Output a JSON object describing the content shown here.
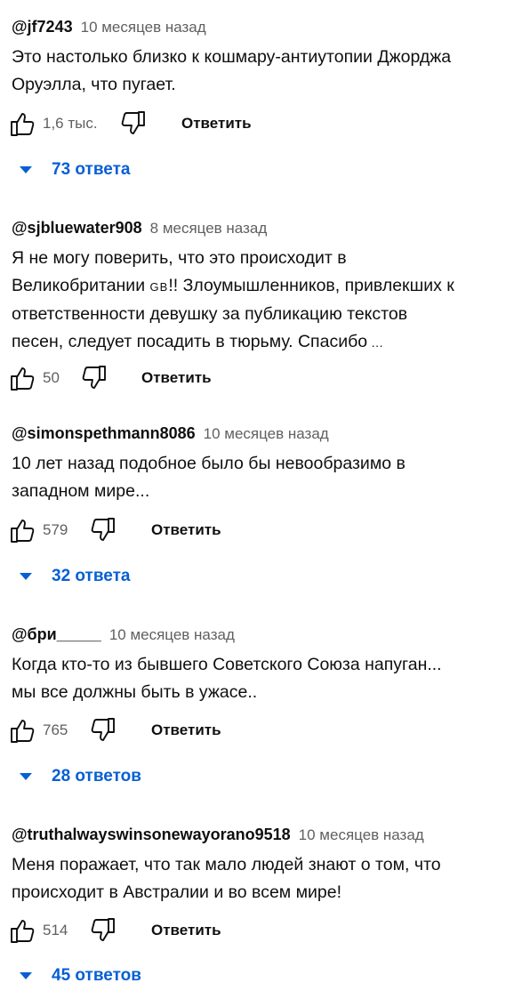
{
  "comments": [
    {
      "author": "@jf7243",
      "time": "10 месяцев назад",
      "lines": [
        "Это настолько близко к кошмару-антиутопии Джорджа",
        "Оруэлла, что пугает."
      ],
      "likes": "1,6 тыс.",
      "reply_label": "Ответить",
      "replies": "73 ответа"
    },
    {
      "author": "@sjbluewater908",
      "time": "8 месяцев назад",
      "lines": [
        "Я не могу поверить, что это происходит в",
        "Великобритании",
        "!! Злоумышленников, привлекших к",
        "ответственности девушку за публикацию текстов",
        "песен, следует посадить в тюрьму. Спасибо"
      ],
      "flag_text": "GB",
      "truncation": "…",
      "likes": "50",
      "reply_label": "Ответить"
    },
    {
      "author": "@simonspethmann8086",
      "time": "10 месяцев назад",
      "lines": [
        "10 лет назад подобное было бы невообразимо в",
        "западном мире..."
      ],
      "likes": "579",
      "reply_label": "Ответить",
      "replies": "32 ответа"
    },
    {
      "author": "@бри_____",
      "time": "10 месяцев назад",
      "lines": [
        "Когда кто-то из бывшего Советского Союза напуган...",
        "мы все должны быть в ужасе.."
      ],
      "likes": "765",
      "reply_label": "Ответить",
      "replies": "28 ответов"
    },
    {
      "author": "@truthalwayswinsonewayorano9518",
      "time": "10 месяцев назад",
      "lines": [
        "Меня поражает, что так мало людей знают о том, что",
        "происходит в Австралии и во всем мире!"
      ],
      "likes": "514",
      "reply_label": "Ответить",
      "replies": "45 ответов"
    }
  ],
  "icons": {
    "like": "thumbs-up-icon",
    "dislike": "thumbs-down-icon",
    "expand": "triangle-down-icon"
  },
  "colors": {
    "link": "#065fd4",
    "meta": "#606060",
    "text": "#0f0f0f"
  }
}
